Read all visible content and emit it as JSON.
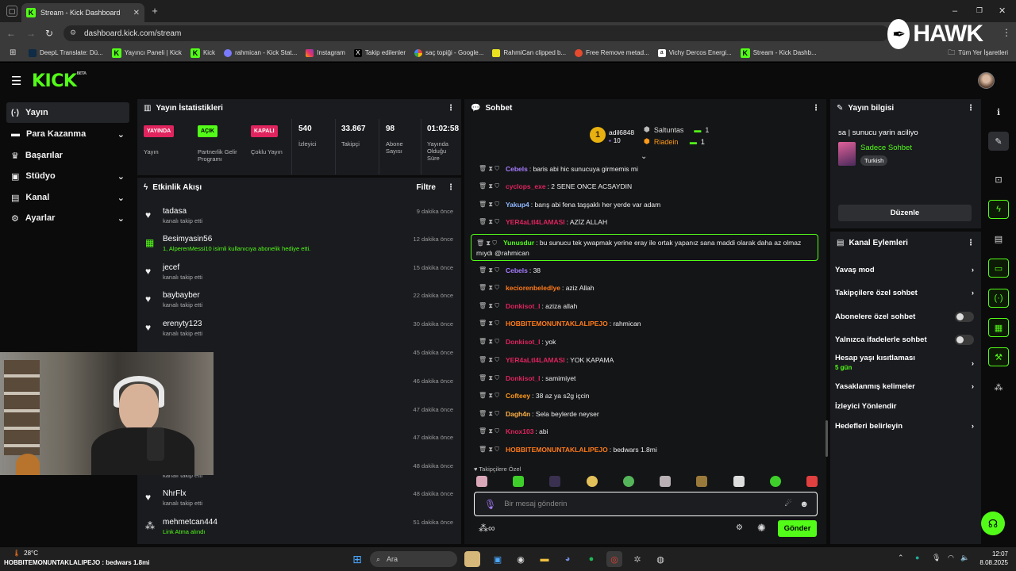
{
  "browser": {
    "tab_title": "Stream - Kick Dashboard",
    "url": "dashboard.kick.com/stream",
    "bookmarks": [
      "DeepL Translate: Dü...",
      "Yayıncı Paneli | Kick",
      "Kick",
      "rahmican - Kick Stat...",
      "Instagram",
      "Takip edilenler",
      "saç topiği - Google...",
      "RahmiCan clipped b...",
      "Free Remove metad...",
      "Vichy Dercos Energi...",
      "Stream - Kick Dashb..."
    ],
    "all_bookmarks": "Tüm Yer İşaretleri",
    "overlay_logo": "HAWK"
  },
  "app": {
    "logo": "KICK",
    "logo_tag": "BETA",
    "nav": [
      {
        "label": "Yayın"
      },
      {
        "label": "Para Kazanma"
      },
      {
        "label": "Başarılar"
      },
      {
        "label": "Stüdyo"
      },
      {
        "label": "Kanal"
      },
      {
        "label": "Ayarlar"
      }
    ]
  },
  "stats": {
    "title": "Yayın İstatistikleri",
    "items": [
      {
        "badge": "YAYINDA",
        "label": "Yayın",
        "color": "#e0245e"
      },
      {
        "badge": "AÇIK",
        "label": "Partnerlik Gelir Programı",
        "color": "#53fc18"
      },
      {
        "badge": "KAPALI",
        "label": "Çoklu Yayın",
        "color": "#e0245e"
      },
      {
        "value": "540",
        "label": "İzleyici"
      },
      {
        "value": "33.867",
        "label": "Takipçi"
      },
      {
        "value": "98",
        "label": "Abone Sayısı"
      },
      {
        "value": "01:02:58",
        "label": "Yayında Olduğu Süre"
      }
    ]
  },
  "activity": {
    "title": "Etkinlik Akışı",
    "filter": "Filtre",
    "items": [
      {
        "name": "tadasa",
        "sub": "kanalı takip etti",
        "time": "9 dakika önce"
      },
      {
        "name": "Besimyasin56",
        "sub": "1, AlperenMessi10 isimli kullanıcıya abonelik hediye etti.",
        "time": "12 dakika önce"
      },
      {
        "name": "jecef",
        "sub": "kanalı takip etti",
        "time": "15 dakika önce"
      },
      {
        "name": "baybayber",
        "sub": "kanalı takip etti",
        "time": "22 dakika önce"
      },
      {
        "name": "erenyty123",
        "sub": "kanalı takip etti",
        "time": "30 dakika önce"
      },
      {
        "name": "",
        "sub": "",
        "time": "45 dakika önce"
      },
      {
        "name": "",
        "sub": "",
        "time": "46 dakika önce"
      },
      {
        "name": "",
        "sub": "",
        "time": "47 dakika önce"
      },
      {
        "name": "",
        "sub": "",
        "time": "47 dakika önce"
      },
      {
        "name": "",
        "sub": "kanalı takip etti",
        "time": "48 dakika önce"
      },
      {
        "name": "NhrFlx",
        "sub": "kanalı takip etti",
        "time": "48 dakika önce"
      },
      {
        "name": "mehmetcan444",
        "sub": "Link Atma alındı",
        "time": "51 dakika önce"
      }
    ]
  },
  "chat": {
    "title": "Sohbet",
    "top": [
      {
        "rank": "1",
        "name": "adil6848",
        "count": "10"
      },
      {
        "name": "Saltuntas",
        "count": "1"
      },
      {
        "name": "Riadein",
        "count": "1"
      }
    ],
    "messages": [
      {
        "user": "Cebels",
        "text": ": baris abi hic sunucuya girmemis mi",
        "color": "#a67cff"
      },
      {
        "user": "cyclops_exe",
        "text": ": 2 SENE ONCE ACSAYDIN",
        "color": "#e0245e"
      },
      {
        "user": "Yakup4",
        "text": ": barış abi fena taşşaklı her yerde var adam",
        "color": "#8fb8ff"
      },
      {
        "user": "YER4aLtI4LAMASI",
        "text": ": AZİZ ALLAH",
        "color": "#e0245e"
      },
      {
        "user": "Yunusdur",
        "text": ": bu sunucu tek ywapmak yerine eray ile ortak yapanız sana maddi olarak daha az olmaz mıydı @rahmican",
        "color": "#53fc18"
      },
      {
        "user": "Cebels",
        "text": ": 38",
        "color": "#a67cff"
      },
      {
        "user": "keciorenbeledlye",
        "text": ": aziz Allah",
        "color": "#ff7a1a"
      },
      {
        "user": "Donkisot_I",
        "text": ": aziza allah",
        "color": "#e0245e"
      },
      {
        "user": "HOBBITEMONUNTAKLALIPEJO",
        "text": ": rahmican",
        "color": "#ff7a1a"
      },
      {
        "user": "Donkisot_I",
        "text": ": yok",
        "color": "#e0245e"
      },
      {
        "user": "YER4aLtI4LAMASI",
        "text": ": YOK KAPAMA",
        "color": "#e0245e"
      },
      {
        "user": "Donkisot_I",
        "text": ": samimiyet",
        "color": "#e0245e"
      },
      {
        "user": "Cofteey",
        "text": ": 38 az ya s2g içcin",
        "color": "#ff9a1a"
      },
      {
        "user": "Dagh4n",
        "text": ": Sela beylerde neyser",
        "color": "#ffb347"
      },
      {
        "user": "Knox103",
        "text": ": abi",
        "color": "#e0245e"
      },
      {
        "user": "HOBBITEMONUNTAKLALIPEJO",
        "text": ": bedwars 1.8mi",
        "color": "#ff7a1a"
      }
    ],
    "emote_label": "Takipçilere Özel",
    "input_placeholder": "Bir mesaj gönderin",
    "send": "Gönder"
  },
  "info": {
    "title": "Yayın bilgisi",
    "stream_title": "sa | sunucu yarin aciliyo",
    "category": "Sadece Sohbet",
    "tag": "Turkish",
    "edit": "Düzenle"
  },
  "channel_actions": {
    "title": "Kanal Eylemleri",
    "items": [
      {
        "label": "Yavaş mod",
        "type": "chevron"
      },
      {
        "label": "Takipçilere özel sohbet",
        "type": "chevron"
      },
      {
        "label": "Abonelere özel sohbet",
        "type": "toggle"
      },
      {
        "label": "Yalnızca ifadelerle sohbet",
        "type": "toggle"
      },
      {
        "label": "Hesap yaşı kısıtlaması",
        "sub": "5 gün",
        "type": "chevron"
      },
      {
        "label": "Yasaklanmış kelimeler",
        "type": "chevron"
      },
      {
        "label": "İzleyici Yönlendir",
        "type": "none"
      },
      {
        "label": "Hedefleri belirleyin",
        "type": "chevron"
      }
    ]
  },
  "taskbar": {
    "weather": "28°C",
    "ticker": "HOBBITEMONUNTAKLALIPEJO : bedwars 1.8mi",
    "search": "Ara",
    "time": "12:07",
    "date": "8.08.2025"
  }
}
